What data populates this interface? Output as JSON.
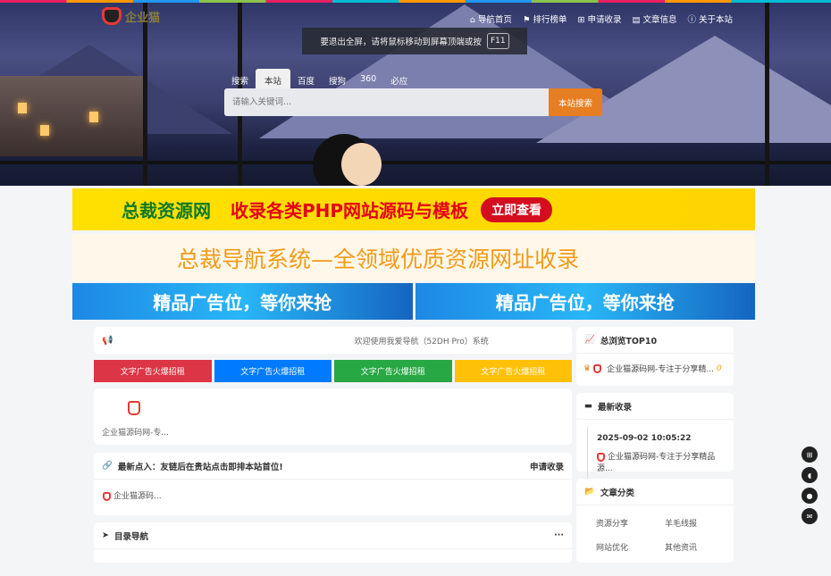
{
  "header": {
    "logo_text": "企业猫",
    "nav": [
      {
        "icon": "home-icon",
        "glyph": "⌂",
        "label": "导航首页"
      },
      {
        "icon": "flag-icon",
        "glyph": "⚑",
        "label": "排行榜单"
      },
      {
        "icon": "plus-square-icon",
        "glyph": "⊞",
        "label": "申请收录"
      },
      {
        "icon": "book-icon",
        "glyph": "▤",
        "label": "文章信息"
      },
      {
        "icon": "info-icon",
        "glyph": "ⓘ",
        "label": "关于本站"
      }
    ]
  },
  "toast": {
    "text": "要退出全屏，请将鼠标移动到屏幕顶端或按",
    "key": "F11"
  },
  "search": {
    "tabs": [
      "搜索",
      "本站",
      "百度",
      "搜狗",
      "360",
      "必应"
    ],
    "active_tab": "本站",
    "placeholder": "请输入关键词...",
    "button": "本站搜索"
  },
  "banners": {
    "b1": {
      "name": "总裁资源网",
      "slogan": "收录各类PHP网站源码与模板",
      "cta": "立即查看"
    },
    "b2": "总裁导航系统—全领域优质资源网址收录",
    "b3": [
      "精品广告位，等你来抢",
      "精品广告位，等你来抢"
    ]
  },
  "notice": {
    "text": "欢迎使用我爱导航（52DH Pro）系统"
  },
  "text_ads": [
    {
      "label": "文字广告火爆招租",
      "color": "#dc3545"
    },
    {
      "label": "文字广告火爆招租",
      "color": "#007bff"
    },
    {
      "label": "文字广告火爆招租",
      "color": "#28a745"
    },
    {
      "label": "文字广告火爆招租",
      "color": "#ffc107"
    }
  ],
  "featured": {
    "site": "企业猫源码网-专..."
  },
  "latest_in": {
    "title": "最新点入：友链后在贵站点击即排本站首位!",
    "apply": "申请收录",
    "site": "企业猫源码..."
  },
  "directory": {
    "title": "目录导航",
    "more": "···"
  },
  "top10": {
    "title": "总浏览TOP10",
    "item": "企业猫源码网-专注于分享精...",
    "count": "0"
  },
  "newest": {
    "title": "最新收录",
    "time": "2025-09-02 10:05:22",
    "item": "企业猫源码网-专注于分享精品源..."
  },
  "categories": {
    "title": "文章分类",
    "items": [
      "资源分享",
      "羊毛线报",
      "网站优化",
      "其他资讯"
    ]
  }
}
